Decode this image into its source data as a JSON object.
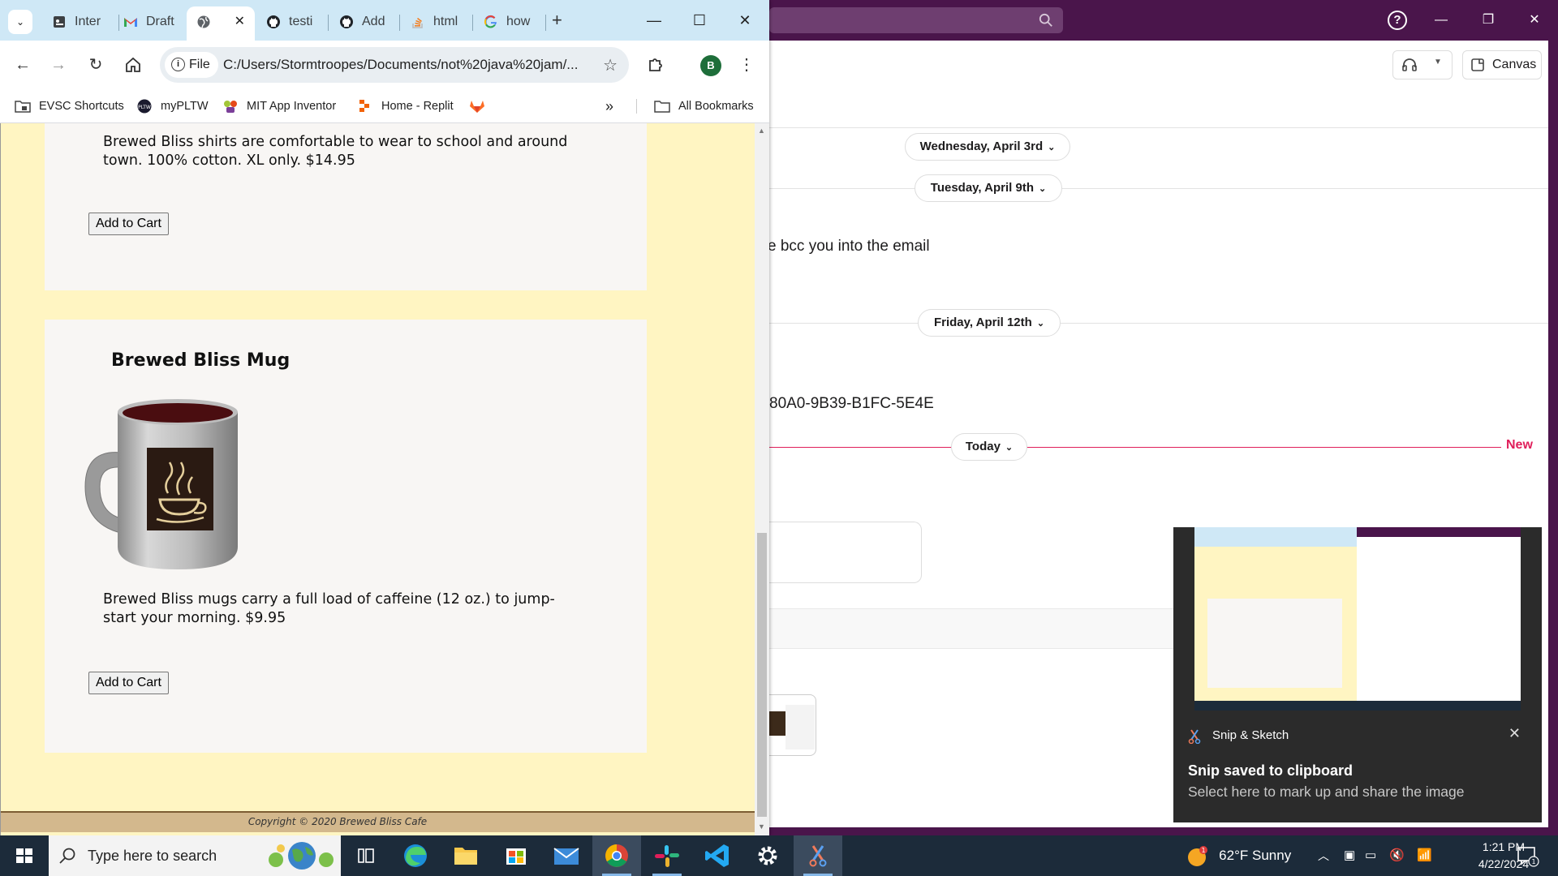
{
  "slack": {
    "canvas_label": "Canvas",
    "dates": [
      "Wednesday, April 3rd",
      "Tuesday, April 9th",
      "Friday, April 12th",
      "Today"
    ],
    "messages": [
      "e bcc you into the email",
      "80A0-9B39-B1FC-5E4E"
    ],
    "new_label": "New",
    "colors": {
      "aubergine": "#4a154b",
      "new": "#e01e5a"
    }
  },
  "browser": {
    "tabs": [
      {
        "title": "Inter",
        "icon": "page-icon"
      },
      {
        "title": "Draft",
        "icon": "gmail-icon"
      },
      {
        "title": "",
        "icon": "globe-icon",
        "active": true
      },
      {
        "title": "testi",
        "icon": "github-icon"
      },
      {
        "title": "Add",
        "icon": "github-icon"
      },
      {
        "title": "html",
        "icon": "stackoverflow-icon"
      },
      {
        "title": "how",
        "icon": "google-icon"
      }
    ],
    "address": {
      "scheme_chip": "File",
      "url": "C:/Users/Stormtroopes/Documents/not%20java%20jam/..."
    },
    "profile_initial": "B",
    "bookmarks": [
      "EVSC Shortcuts",
      "myPLTW",
      "MIT App Inventor",
      "Home - Replit"
    ],
    "all_bookmarks": "All Bookmarks"
  },
  "page": {
    "shirt_desc_line1": "Brewed Bliss shirts are comfortable to wear to school and around",
    "shirt_desc_line2": "town. 100% cotton. XL only. $14.95",
    "add_to_cart": "Add to Cart",
    "mug_title": "Brewed Bliss Mug",
    "mug_desc_line1": "Brewed Bliss mugs carry a full load of caffeine (12 oz.) to jump-",
    "mug_desc_line2": "start your morning. $9.95",
    "footer": "Copyright © 2020 Brewed Bliss Cafe",
    "colors": {
      "background": "#fff5c2",
      "card": "#f8f6f4",
      "footer": "#d3b88d"
    }
  },
  "toast": {
    "app_name": "Snip & Sketch",
    "heading": "Snip saved to clipboard",
    "body": "Select here to mark up and share the image"
  },
  "taskbar": {
    "search_placeholder": "Type here to search",
    "weather": "62°F  Sunny",
    "time": "1:21 PM",
    "date": "4/22/2024",
    "notification_count": "1"
  }
}
